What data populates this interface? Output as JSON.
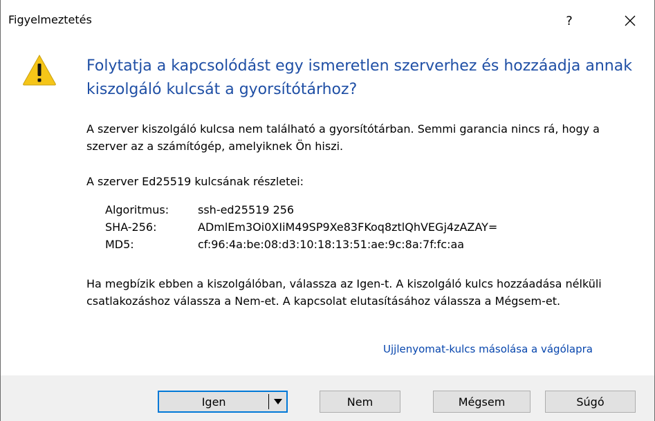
{
  "window": {
    "title": "Figyelmeztetés",
    "help_label": "?"
  },
  "main_instruction": "Folytatja a kapcsolódást egy ismeretlen szerverhez és hozzáadja annak kiszolgáló kulcsát a gyorsítótárhoz?",
  "content": {
    "paragraph1": "A szerver kiszolgáló kulcsa nem található a gyorsítótárban. Semmi garancia nincs rá, hogy a szerver az a számítógép, amelyiknek Ön hiszi.",
    "paragraph2": "A szerver Ed25519 kulcsának részletei:",
    "details": [
      {
        "label": "Algoritmus:",
        "value": "ssh-ed25519 256"
      },
      {
        "label": "SHA-256:",
        "value": "ADmlEm3Oi0XIiM49SP9Xe83FKoq8ztlQhVEGj4zAZAY="
      },
      {
        "label": "MD5:",
        "value": "cf:96:4a:be:08:d3:10:18:13:51:ae:9c:8a:7f:fc:aa"
      }
    ],
    "paragraph3": "Ha megbízik ebben a kiszolgálóban, válassza az Igen-t. A kiszolgáló kulcs hozzáadása nélküli csatlakozáshoz válassza a Nem-et. A kapcsolat elutasításához válassza a Mégsem-et.",
    "copy_link": "Ujjlenyomat-kulcs másolása a vágólapra"
  },
  "buttons": {
    "yes": "Igen",
    "no": "Nem",
    "cancel": "Mégsem",
    "help": "Súgó"
  },
  "icons": {
    "warning": "warning-icon",
    "close": "close-icon",
    "dropdown": "caret-down-icon"
  },
  "colors": {
    "instruction": "#1f4fa5",
    "link": "#0645ad",
    "warning_fill": "#f5c518",
    "default_button_border": "#0078d7"
  }
}
